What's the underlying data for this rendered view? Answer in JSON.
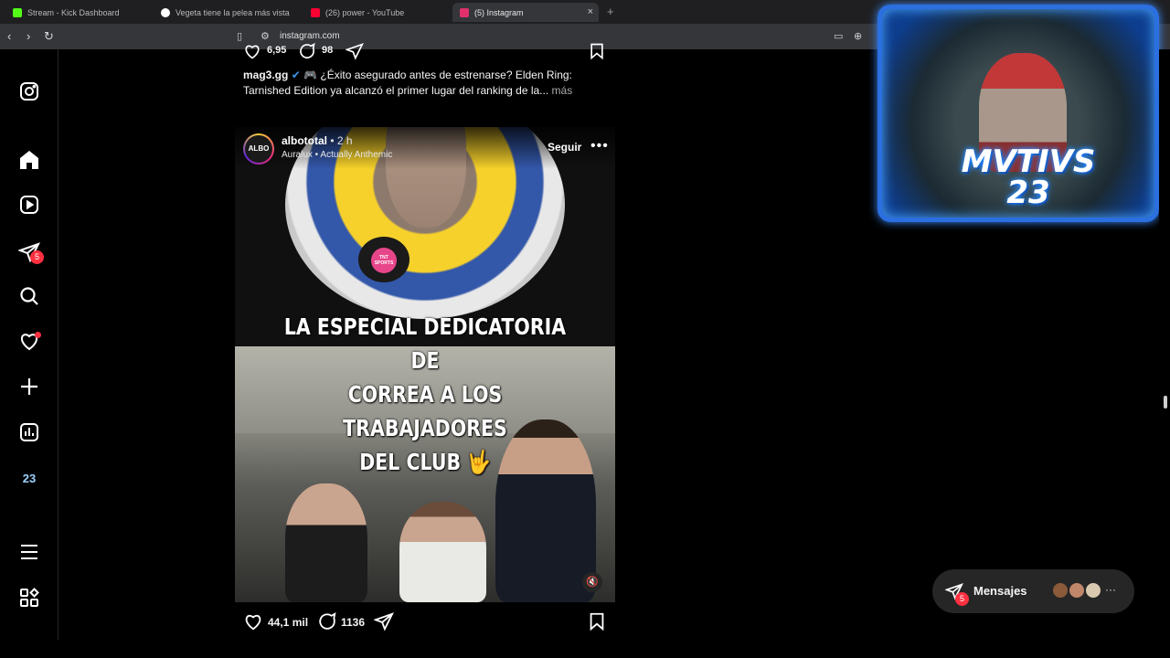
{
  "browser": {
    "tabs": [
      {
        "title": "Stream - Kick Dashboard",
        "favicon_color": "#53fc18"
      },
      {
        "title": "Vegeta tiene la pelea más vista",
        "favicon_color": "#ffffff"
      },
      {
        "title": "(26) power - YouTube",
        "favicon_color": "#ff0033"
      },
      {
        "title": "(5) Instagram",
        "favicon_color": "#e1306c"
      }
    ],
    "new_tab": "+",
    "close_glyph": "×",
    "url": "instagram.com"
  },
  "sidebar": {
    "items": [
      {
        "name": "instagram-logo-icon"
      },
      {
        "name": "home-icon"
      },
      {
        "name": "reels-icon"
      },
      {
        "name": "direct-messages-icon",
        "badge": "5"
      },
      {
        "name": "search-icon"
      },
      {
        "name": "notifications-icon"
      },
      {
        "name": "create-icon"
      },
      {
        "name": "insights-icon"
      },
      {
        "name": "profile-icon",
        "label": "23"
      },
      {
        "name": "menu-icon"
      },
      {
        "name": "more-apps-icon"
      }
    ]
  },
  "previous_post": {
    "likes": "6,95",
    "comments": "98",
    "caption_user": "mag3.gg",
    "caption_text": "🎮 ¿Éxito asegurado antes de estrenarse? Elden Ring: Tarnished Edition ya alcanzó el primer lugar del ranking de la...",
    "more": "más"
  },
  "post": {
    "avatar_text": "ALBO",
    "username": "albototal",
    "time": "• 2 h",
    "audio": "Auralux • Actually Anthemic",
    "follow": "Seguir",
    "options": "•••",
    "headline_line1": "LA ESPECIAL DEDICATORIA DE",
    "headline_line2": "CORREA A LOS TRABAJADORES",
    "headline_line3": "DEL CLUB 🤟",
    "mic_text": "TNT SPORTS",
    "likes": "44,1 mil",
    "comments": "1136"
  },
  "webcam": {
    "logo_line1": "MVTIVS",
    "logo_line2": "23"
  },
  "messages": {
    "label": "Mensajes",
    "badge": "5",
    "more": "···"
  },
  "colors": {
    "accent": "#ff3040",
    "webcam_border": "#2b6fe0"
  }
}
